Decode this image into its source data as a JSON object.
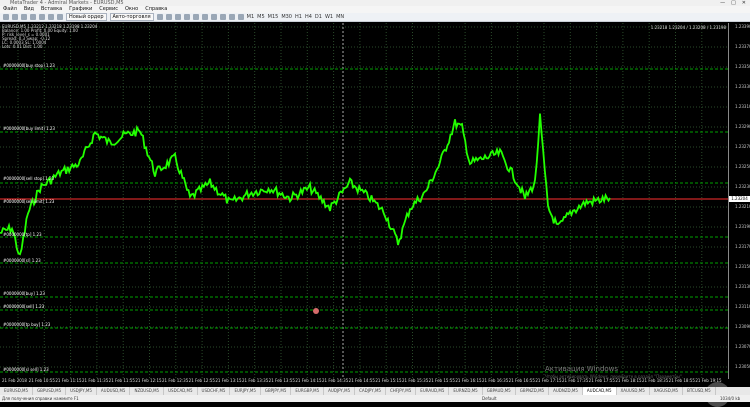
{
  "window": {
    "title": "MetaTrader 4 - Admiral Markets - EURUSD,M5",
    "controls": [
      "—",
      "□",
      "✕"
    ]
  },
  "menu": [
    "Файл",
    "Вид",
    "Вставка",
    "Графики",
    "Сервис",
    "Окно",
    "Справка"
  ],
  "toolbar": {
    "new_order": "Новый ордер",
    "autotrading": "Авто-торговля",
    "timeframes": [
      "M1",
      "M5",
      "M15",
      "M30",
      "H1",
      "H4",
      "D1",
      "W1",
      "MN"
    ]
  },
  "chart": {
    "symbol_info": [
      "EURUSD,M5 1.23212 1.23218 1.23198 1.23204",
      "Balance: 1.00 Profit: 0.00 Equity: 1.00",
      "P: risk_level_s = 0.0001",
      "Spread: 0.3 Swap: -0.12",
      "LC: 0.0003 SL: 1.0004",
      "Lots: 0.01 Dist: 1.00"
    ],
    "top_right": "1.23218 1.23204 / 1.23208 / 1.23198",
    "price_levels": [
      "1.23390",
      "1.23370",
      "1.23350",
      "1.23330",
      "1.23310",
      "1.23290",
      "1.23270",
      "1.23250",
      "1.23230",
      "1.23210",
      "1.23190",
      "1.23170",
      "1.23150",
      "1.23130",
      "1.23110",
      "1.23090",
      "1.23070",
      "1.23050"
    ],
    "current_price": "1.23204",
    "level_labels": [
      "#0000000[buy stop] 1.23",
      "#0000000[buy limit] 1.23",
      "#0000000[sell stop] 1.23",
      "#0000000[sell limit] 1.23",
      "#0000000[tp] 1.23",
      "#0000000[sl] 1.23",
      "#0000000[buy] 1.23",
      "#0000000[sell] 1.23",
      "#0000000[tp buy] 1.23",
      "#0000000[sl sell] 1.23"
    ],
    "time_labels": [
      "21 Feb 2018",
      "21 Feb 10:55",
      "21 Feb 11:15",
      "21 Feb 11:35",
      "21 Feb 11:55",
      "21 Feb 12:15",
      "21 Feb 12:35",
      "21 Feb 12:55",
      "21 Feb 13:15",
      "21 Feb 13:35",
      "21 Feb 13:55",
      "21 Feb 14:15",
      "21 Feb 14:35",
      "21 Feb 14:55",
      "21 Feb 15:15",
      "21 Feb 15:35",
      "21 Feb 15:55",
      "21 Feb 16:15",
      "21 Feb 16:35",
      "21 Feb 16:55",
      "21 Feb 17:15",
      "21 Feb 17:35",
      "21 Feb 17:55",
      "21 Feb 18:15",
      "21 Feb 18:35",
      "21 Feb 18:55",
      "21 Feb 19:15"
    ],
    "line_color": "#22ff00",
    "grid_color": "#2a4a2a",
    "level_color": "#00a000",
    "current_line_color": "#ff3030"
  },
  "tabs": [
    "EURUSD,M5",
    "GBPUSD,M5",
    "USDJPY,M5",
    "AUDUSD,M5",
    "NZDUSD,M5",
    "USDCAD,M5",
    "USDCHF,M5",
    "EURJPY,M5",
    "GBPJPY,M5",
    "EURGBP,M5",
    "AUDJPY,M5",
    "CADJPY,M5",
    "CHFJPY,M5",
    "EURAUD,M5",
    "EURNZD,M5",
    "GBPAUD,M5",
    "GBPNZD,M5",
    "AUDNZD,M5",
    "AUDCAD,M5",
    "XAUUSD,M5",
    "XAGUSD,M5",
    "BTCUSD,M5"
  ],
  "active_tab_index": 18,
  "status": {
    "left": "Для получения справки нажмите F1",
    "middle": "Default",
    "right": "1034/0 kb"
  },
  "watermark": {
    "line1": "Активация Windows",
    "line2": "Чтобы активировать Windows, перейдите в раздел \"Параметры\"."
  }
}
